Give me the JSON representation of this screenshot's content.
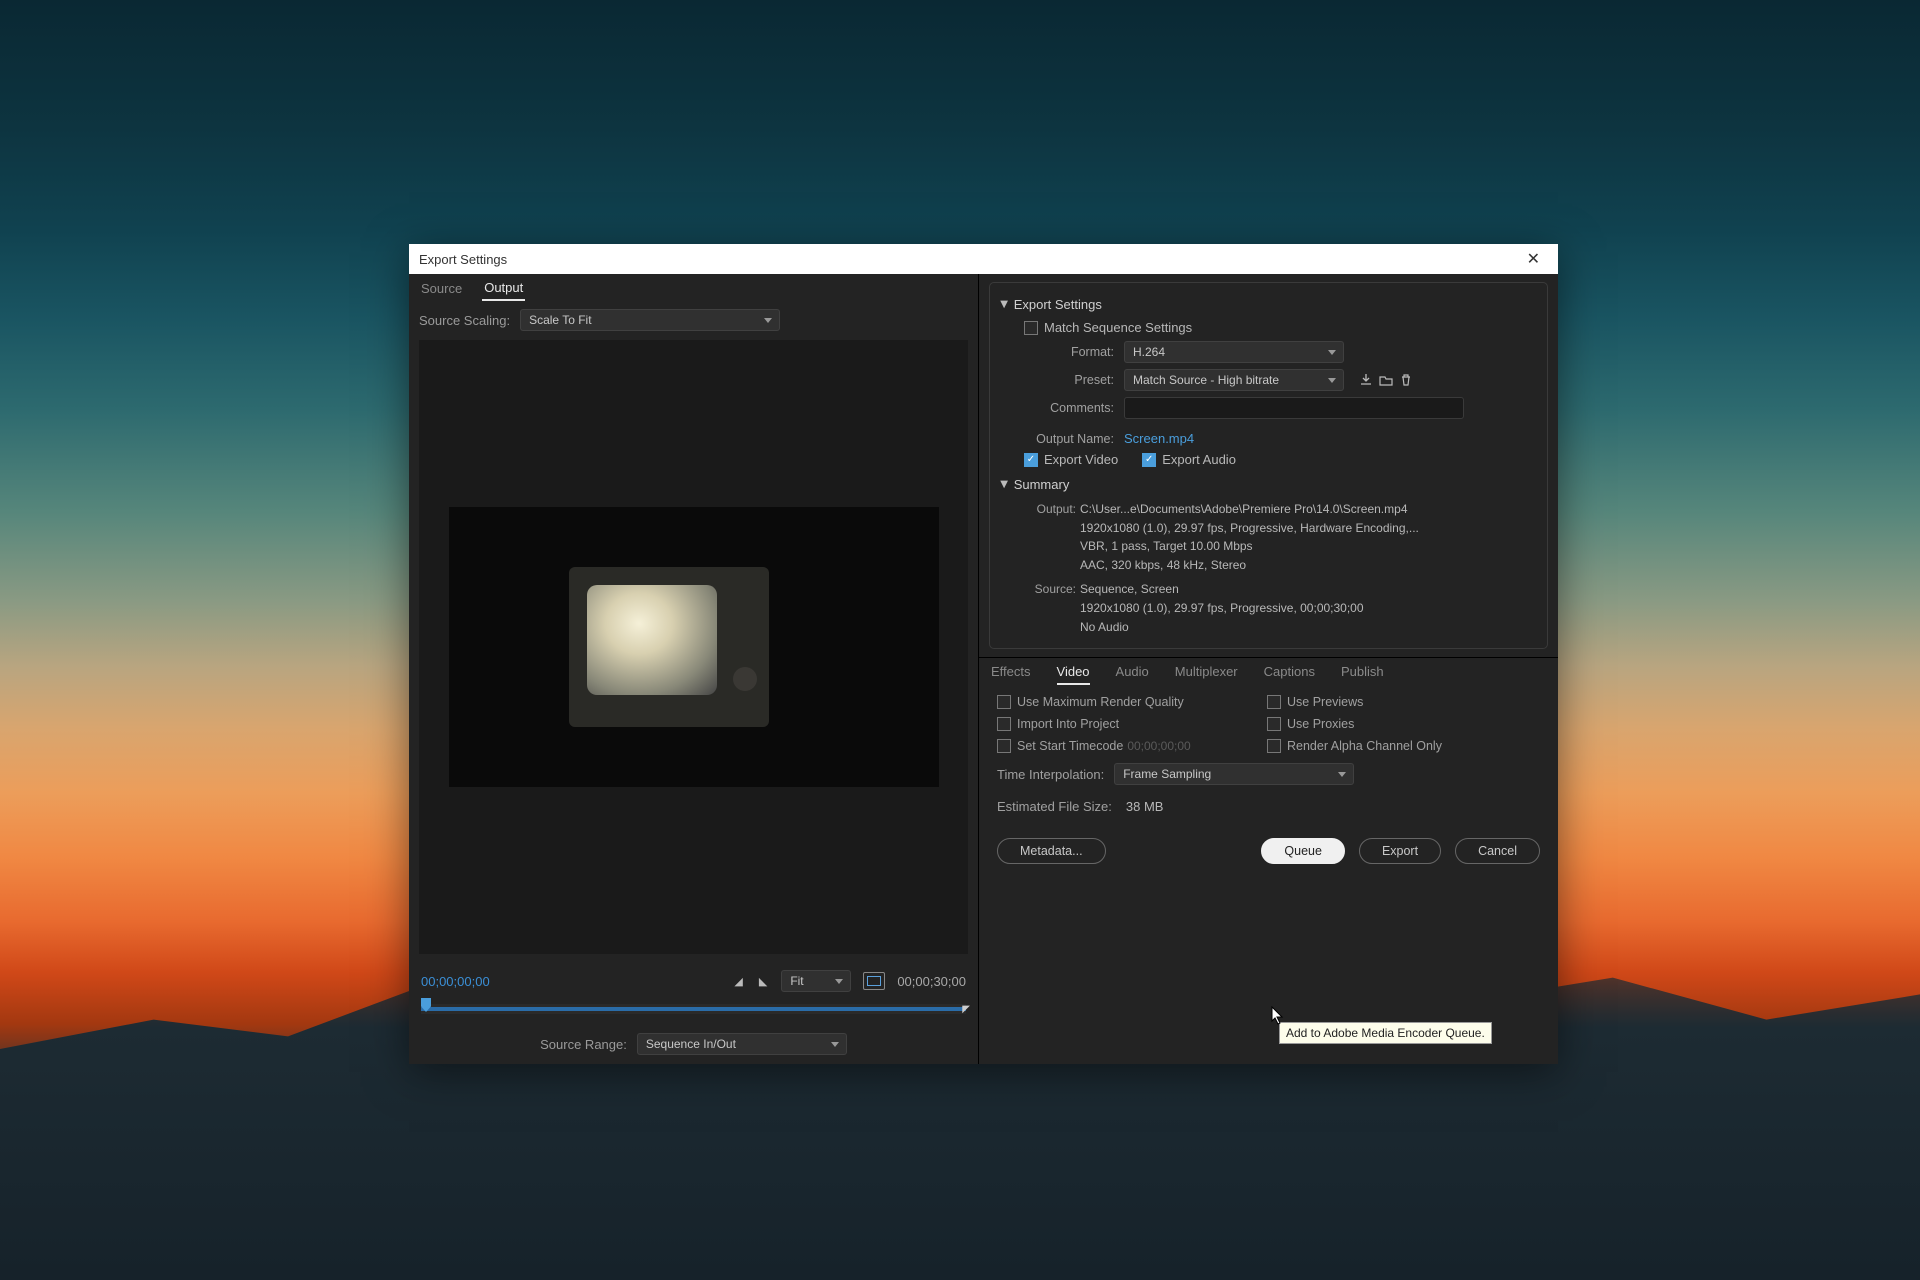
{
  "dialog": {
    "title": "Export Settings"
  },
  "left": {
    "tabs": [
      "Source",
      "Output"
    ],
    "active_tab": 1,
    "source_scaling_label": "Source Scaling:",
    "source_scaling_value": "Scale To Fit",
    "time_in": "00;00;00;00",
    "time_out": "00;00;30;00",
    "fit_label": "Fit",
    "source_range_label": "Source Range:",
    "source_range_value": "Sequence In/Out"
  },
  "export": {
    "section_title": "Export Settings",
    "match_seq_label": "Match Sequence Settings",
    "match_seq_checked": false,
    "format_label": "Format:",
    "format_value": "H.264",
    "preset_label": "Preset:",
    "preset_value": "Match Source - High bitrate",
    "comments_label": "Comments:",
    "output_name_label": "Output Name:",
    "output_name_value": "Screen.mp4",
    "export_video_label": "Export Video",
    "export_video_checked": true,
    "export_audio_label": "Export Audio",
    "export_audio_checked": true,
    "summary_title": "Summary",
    "summary_output_label": "Output:",
    "summary_output": "C:\\User...e\\Documents\\Adobe\\Premiere Pro\\14.0\\Screen.mp4\n1920x1080 (1.0), 29.97 fps, Progressive, Hardware Encoding,...\nVBR, 1 pass, Target 10.00 Mbps\nAAC, 320 kbps, 48 kHz, Stereo",
    "summary_source_label": "Source:",
    "summary_source": "Sequence, Screen\n1920x1080 (1.0), 29.97 fps, Progressive, 00;00;30;00\nNo Audio"
  },
  "tabs2": {
    "items": [
      "Effects",
      "Video",
      "Audio",
      "Multiplexer",
      "Captions",
      "Publish"
    ],
    "active": 1
  },
  "opts": {
    "max_render": "Use Maximum Render Quality",
    "previews": "Use Previews",
    "import": "Import Into Project",
    "proxies": "Use Proxies",
    "start_tc": "Set Start Timecode",
    "start_tc_value": "00;00;00;00",
    "alpha": "Render Alpha Channel Only",
    "time_interp_label": "Time Interpolation:",
    "time_interp_value": "Frame Sampling",
    "est_label": "Estimated File Size:",
    "est_value": "38 MB"
  },
  "buttons": {
    "metadata": "Metadata...",
    "queue": "Queue",
    "export": "Export",
    "cancel": "Cancel"
  },
  "tooltip": "Add to Adobe Media Encoder Queue."
}
